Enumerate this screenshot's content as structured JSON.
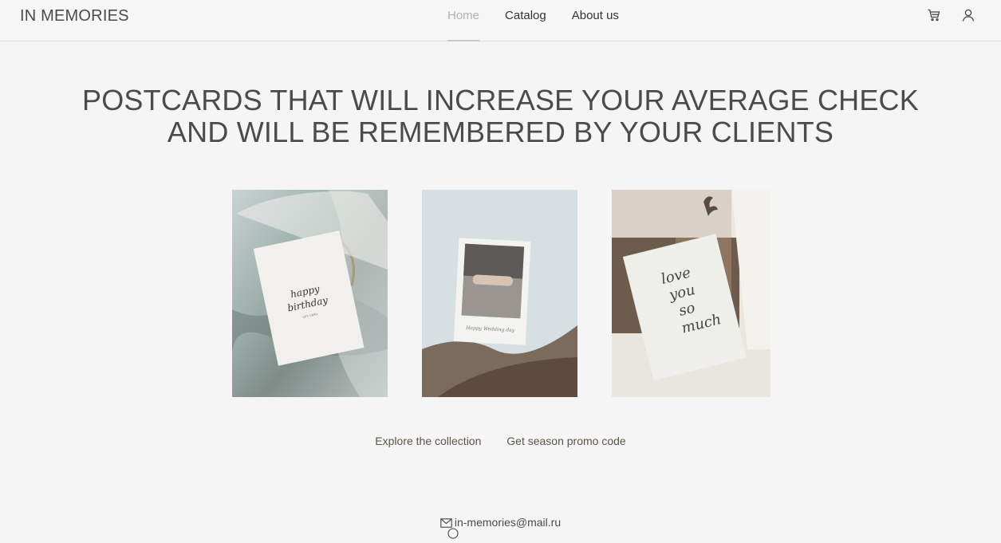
{
  "header": {
    "logo": "IN MEMORIES",
    "nav": [
      {
        "label": "Home",
        "active": true
      },
      {
        "label": "Catalog",
        "active": false
      },
      {
        "label": "About us",
        "active": false
      }
    ],
    "icons": [
      "cart-icon",
      "user-icon"
    ]
  },
  "hero": {
    "line1": "POSTCARDS THAT WILL INCREASE YOUR AVERAGE CHECK",
    "line2": "AND WILL BE REMEMBERED BY YOUR CLIENTS"
  },
  "gallery": {
    "cards": [
      {
        "text1": "happy",
        "text2": "birthday",
        "small": "GIFT CARD"
      },
      {
        "caption": "Happy Wedding day"
      },
      {
        "text1": "love",
        "text2": "you",
        "text3": "so",
        "text4": "much"
      }
    ]
  },
  "actions": {
    "explore": "Explore the collection",
    "promo": "Get season promo code"
  },
  "footer": {
    "email": "in-memories@mail.ru"
  },
  "colors": {
    "background": "#f5f5f5",
    "text": "#4a4a4a",
    "accent_link": "#5e5345",
    "nav_active": "#b3b3b3"
  }
}
